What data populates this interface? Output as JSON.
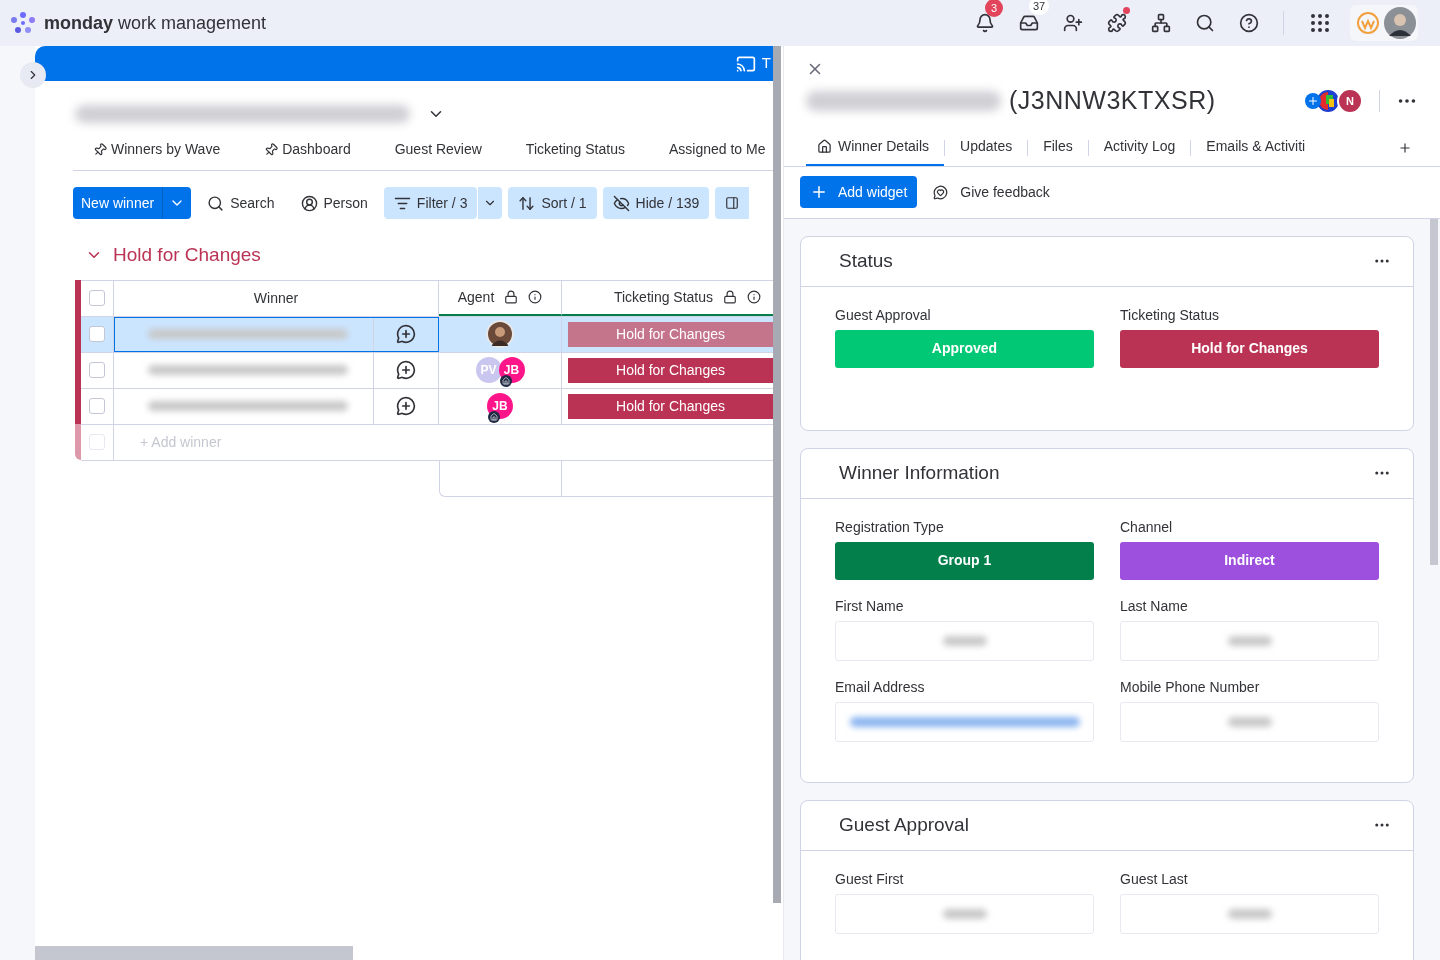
{
  "topbar": {
    "brand_bold": "monday",
    "brand_rest": "work management",
    "notifications_count": "3",
    "inbox_count": "37",
    "apps_dot": true
  },
  "board": {
    "header_text": "T",
    "views": [
      {
        "label": "Winners by Wave",
        "pinned": true
      },
      {
        "label": "Dashboard",
        "pinned": true
      },
      {
        "label": "Guest Review"
      },
      {
        "label": "Ticketing Status"
      },
      {
        "label": "Assigned to Me"
      }
    ],
    "new_button": "New winner",
    "tools": [
      {
        "kind": "search",
        "label": "Search",
        "active": false
      },
      {
        "kind": "person",
        "label": "Person",
        "active": false
      },
      {
        "kind": "filter",
        "label": "Filter / 3",
        "active": true
      },
      {
        "kind": "sort",
        "label": "Sort / 1",
        "active": true
      },
      {
        "kind": "hide",
        "label": "Hide / 139",
        "active": true
      }
    ],
    "group": {
      "title": "Hold for Changes",
      "color": "#bb3354",
      "columns": [
        "Winner",
        "Agent",
        "Ticketing Status"
      ],
      "rows": [
        {
          "selected": true,
          "agents": [
            {
              "kind": "photo"
            }
          ],
          "status": {
            "label": "Hold for Changes",
            "color": "#c4758b"
          }
        },
        {
          "selected": false,
          "agents": [
            {
              "kind": "initials",
              "initials": "PV",
              "color": "#c9c6f0"
            },
            {
              "kind": "initials",
              "initials": "JB",
              "color": "#ff158a",
              "home": true
            }
          ],
          "status": {
            "label": "Hold for Changes",
            "color": "#bb3354"
          }
        },
        {
          "selected": false,
          "agents": [
            {
              "kind": "initials",
              "initials": "JB",
              "color": "#ff158a",
              "home": true
            }
          ],
          "status": {
            "label": "Hold for Changes",
            "color": "#bb3354"
          }
        }
      ],
      "header_checkbox": {
        "checked": false
      },
      "add_row_checkbox": {
        "checked": false
      },
      "add_row": "+ Add winner"
    }
  },
  "detail": {
    "title_id": "(J3NNW3KTXSR)",
    "owner_initial": "N",
    "tabs": [
      {
        "label": "Winner Details",
        "selected": true
      },
      {
        "label": "Updates",
        "selected": false
      },
      {
        "label": "Files",
        "selected": false
      },
      {
        "label": "Activity Log",
        "selected": false
      },
      {
        "label": "Emails & Activiti",
        "selected": false
      }
    ],
    "add_widget": "Add widget",
    "feedback": "Give feedback",
    "widgets": [
      {
        "title": "Status",
        "fields": [
          {
            "kind": "status",
            "label": "Guest Approval",
            "value": "Approved",
            "color": "#00c875"
          },
          {
            "kind": "status",
            "label": "Ticketing Status",
            "value": "Hold for Changes",
            "color": "#bb3354"
          }
        ]
      },
      {
        "title": "Winner Information",
        "fields": [
          {
            "kind": "status",
            "label": "Registration Type",
            "value": "Group 1",
            "color": "#037f4c"
          },
          {
            "kind": "status",
            "label": "Channel",
            "value": "Indirect",
            "color": "#9d50dd"
          },
          {
            "kind": "text",
            "label": "First Name"
          },
          {
            "kind": "text",
            "label": "Last Name"
          },
          {
            "kind": "email",
            "label": "Email Address"
          },
          {
            "kind": "text",
            "label": "Mobile Phone Number"
          }
        ]
      },
      {
        "title": "Guest Approval",
        "fields": [
          {
            "kind": "text",
            "label": "Guest First"
          },
          {
            "kind": "text",
            "label": "Guest Last"
          }
        ]
      }
    ]
  }
}
